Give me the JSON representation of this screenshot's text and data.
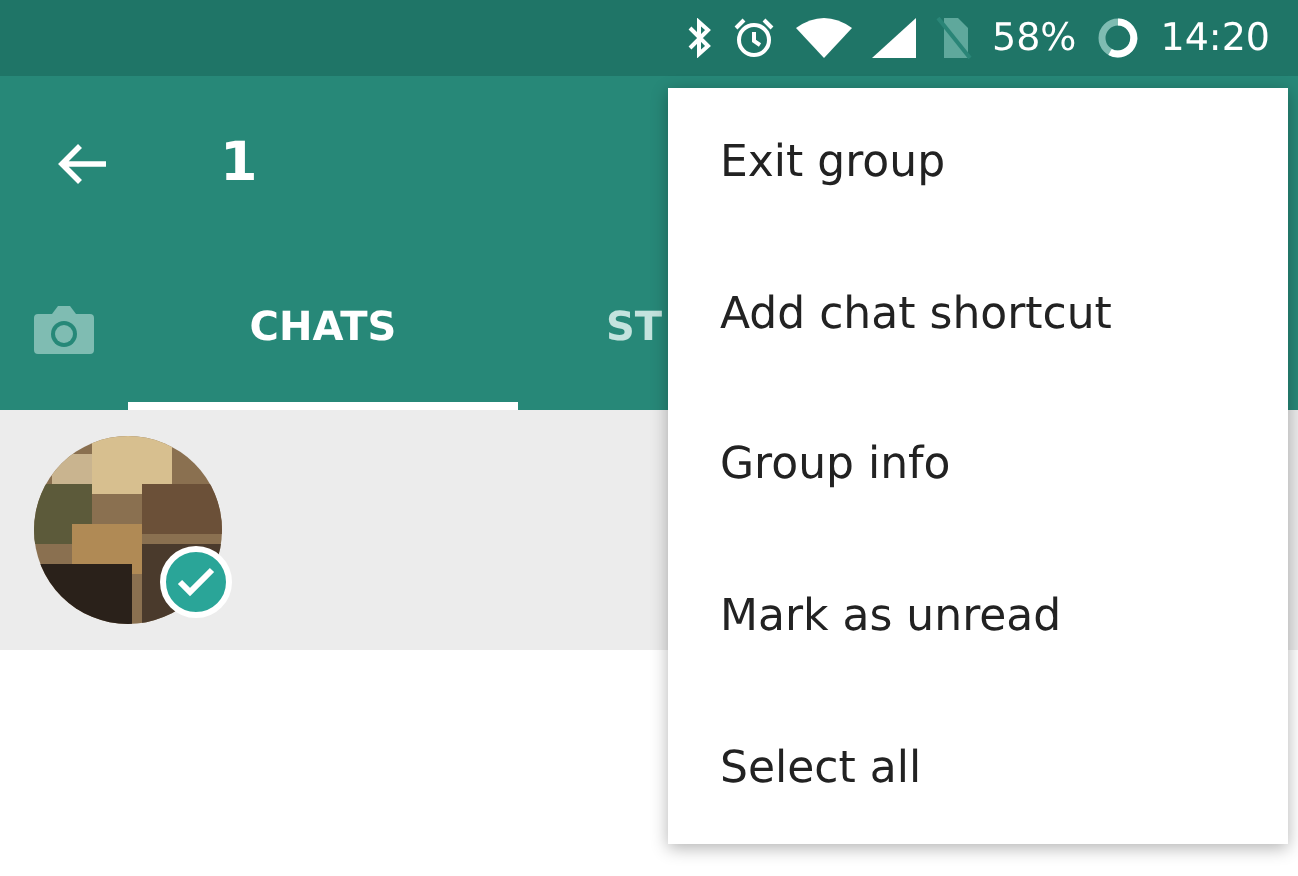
{
  "status_bar": {
    "battery": "58%",
    "time": "14:20"
  },
  "toolbar": {
    "title": "1"
  },
  "tabs": [
    {
      "label": "CHATS",
      "selected": true
    },
    {
      "label": "ST",
      "selected": false
    }
  ],
  "chats": [
    {
      "selected": true
    }
  ],
  "menu": {
    "items": [
      "Exit group",
      "Add chat shortcut",
      "Group info",
      "Mark as unread",
      "Select all"
    ]
  }
}
